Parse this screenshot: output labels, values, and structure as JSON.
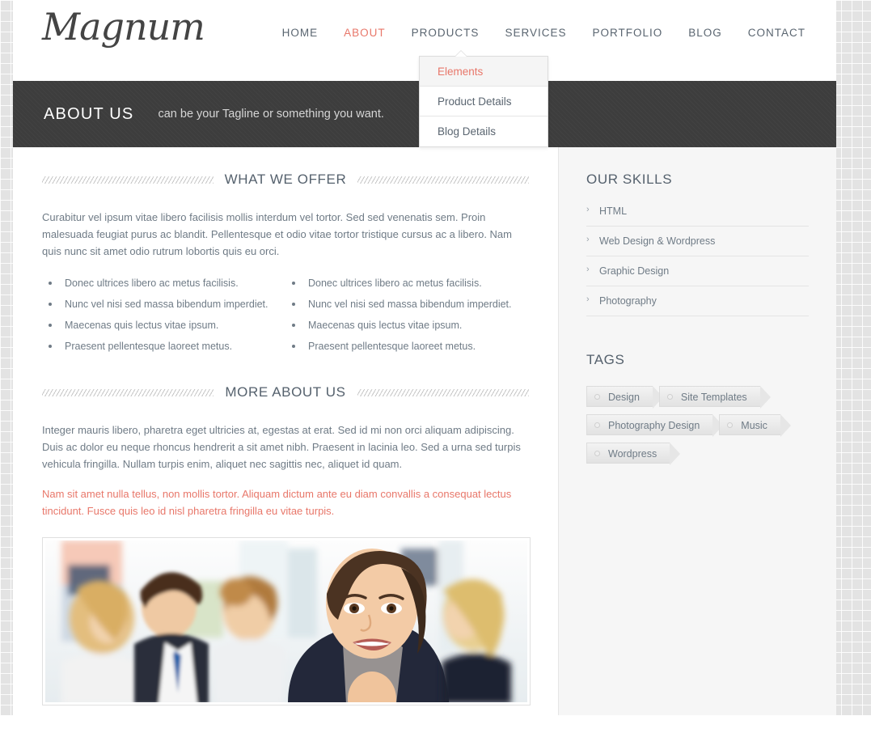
{
  "site": {
    "logo": "Magnum"
  },
  "nav": {
    "items": [
      {
        "label": "HOME",
        "active": false
      },
      {
        "label": "ABOUT",
        "active": true
      },
      {
        "label": "PRODUCTS",
        "active": false
      },
      {
        "label": "SERVICES",
        "active": false
      },
      {
        "label": "PORTFOLIO",
        "active": false
      },
      {
        "label": "BLOG",
        "active": false
      },
      {
        "label": "CONTACT",
        "active": false
      }
    ],
    "dropdown": {
      "items": [
        {
          "label": "Elements",
          "active": true
        },
        {
          "label": "Product Details",
          "active": false
        },
        {
          "label": "Blog Details",
          "active": false
        }
      ]
    }
  },
  "banner": {
    "title": "ABOUT US",
    "tagline": "can be your Tagline or something you want."
  },
  "content": {
    "offer": {
      "heading": "WHAT WE OFFER",
      "paragraph": "Curabitur vel ipsum vitae libero facilisis mollis interdum vel tortor. Sed sed venenatis sem. Proin malesuada feugiat purus ac blandit. Pellentesque et odio vitae tortor tristique cursus ac a libero. Nam quis nunc sit amet odio rutrum lobortis quis eu orci.",
      "list_left": [
        "Donec ultrices libero ac metus facilisis.",
        "Nunc vel nisi sed massa bibendum imperdiet.",
        "Maecenas quis lectus vitae ipsum.",
        "Praesent pellentesque laoreet metus."
      ],
      "list_right": [
        "Donec ultrices libero ac metus facilisis.",
        "Nunc vel nisi sed massa bibendum imperdiet.",
        "Maecenas quis lectus vitae ipsum.",
        "Praesent pellentesque laoreet metus."
      ]
    },
    "more": {
      "heading": "MORE ABOUT US",
      "paragraph": "Integer mauris libero, pharetra eget ultricies at, egestas at erat. Sed id mi non orci aliquam adipiscing. Duis ac dolor eu neque rhoncus hendrerit a sit amet nibh. Praesent in lacinia leo. Sed a urna sed turpis vehicula fringilla. Nullam turpis enim, aliquet nec sagittis nec, aliquet id quam.",
      "accent_paragraph": "Nam sit amet nulla tellus, non mollis tortor. Aliquam dictum ante eu diam convallis a consequat lectus tincidunt. Fusce quis leo id nisl pharetra fringilla eu vitae turpis."
    },
    "photo_alt": "business-team-photo"
  },
  "sidebar": {
    "skills": {
      "heading": "OUR SKILLS",
      "items": [
        "HTML",
        "Web Design & Wordpress",
        "Graphic Design",
        "Photography"
      ],
      "chevron": "›"
    },
    "tags": {
      "heading": "TAGS",
      "items": [
        "Design",
        "Site Templates",
        "Photography Design",
        "Music",
        "Wordpress"
      ]
    }
  },
  "colors": {
    "accent": "#e8776a",
    "banner_bg": "#3d3d3d",
    "body_text": "#6f7b86",
    "heading_text": "#55616d",
    "sidebar_bg": "#f6f6f6"
  }
}
